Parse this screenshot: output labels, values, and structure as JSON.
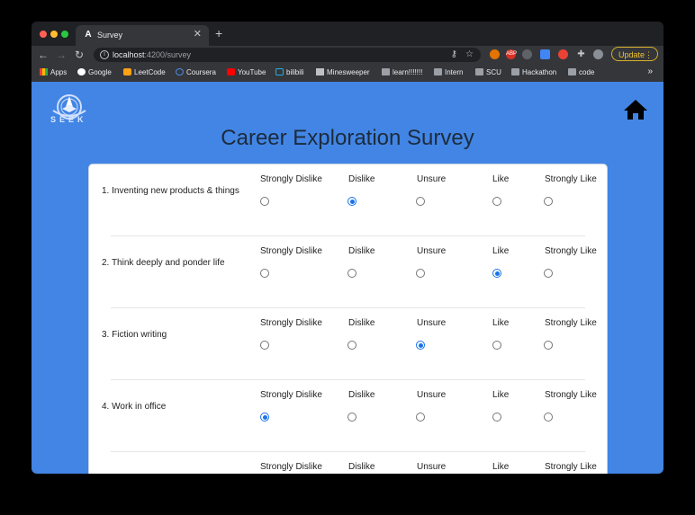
{
  "browser": {
    "tab_title": "Survey",
    "tab_favicon": "A",
    "url_host": "localhost",
    "url_path": ":4200/survey",
    "update_label": "Update",
    "bookmarks": [
      "Apps",
      "Google",
      "LeetCode",
      "Coursera",
      "YouTube",
      "bilibili",
      "Minesweeper",
      "learn!!!!!!!",
      "Intern",
      "SCU",
      "Hackathon",
      "code"
    ],
    "more_bookmarks": "»"
  },
  "page": {
    "logo_text": "SEEK",
    "title": "Career Exploration Survey"
  },
  "survey": {
    "options": [
      "Strongly Dislike",
      "Dislike",
      "Unsure",
      "Like",
      "Strongly Like"
    ],
    "questions": [
      {
        "label": "1. Inventing new products & things",
        "selected": 1
      },
      {
        "label": "2. Think deeply and ponder life",
        "selected": 3
      },
      {
        "label": "3. Fiction writing",
        "selected": 2
      },
      {
        "label": "4. Work in office",
        "selected": 0
      },
      {
        "label": "",
        "selected": -1
      }
    ]
  },
  "colors": {
    "page_background": "#4285e4",
    "radio_checked": "#1a73e8",
    "update_accent": "#f1c232"
  }
}
